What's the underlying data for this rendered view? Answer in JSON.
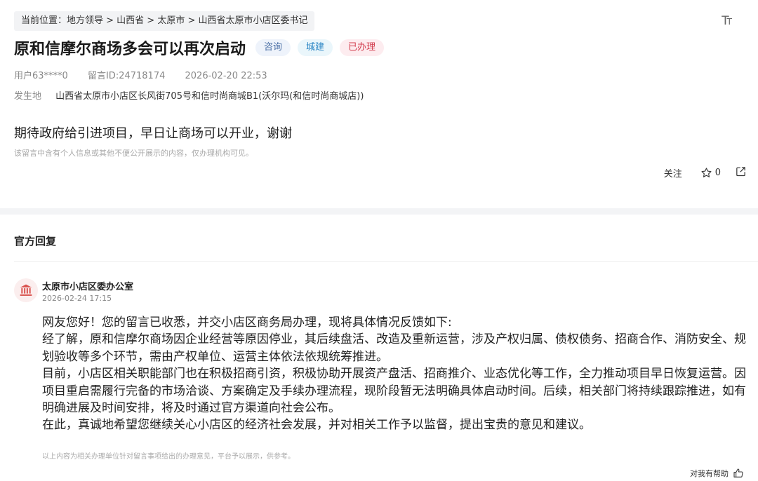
{
  "breadcrumb": "当前位置：地方领导 > 山西省 > 太原市 > 山西省太原市小店区委书记",
  "font_toggle": {
    "big": "T",
    "small": "T"
  },
  "title": "原和信摩尔商场多会可以再次启动",
  "tags": {
    "consult": "咨询",
    "city": "城建",
    "status": "已办理"
  },
  "meta": {
    "user": "用户63****0",
    "message_id": "留言ID:24718174",
    "datetime": "2026-02-20 22:53"
  },
  "location": {
    "label": "发生地",
    "value": "山西省太原市小店区长风街705号和信时尚商城B1(沃尔玛(和信时尚商城店))"
  },
  "content": "期待政府给引进项目，早日让商场可以开业，谢谢",
  "privacy_note": "该留言中含有个人信息或其他不便公开展示的内容，仅办理机构可见。",
  "actions": {
    "follow": "关注",
    "star_count": "0"
  },
  "official": {
    "section_title": "官方回复",
    "office": "太原市小店区委办公室",
    "time": "2026-02-24 17:15",
    "reply": [
      "网友您好！您的留言已收悉，并交小店区商务局办理，现将具体情况反馈如下:",
      "经了解，原和信摩尔商场因企业经营等原因停业，其后续盘活、改造及重新运营，涉及产权归属、债权债务、招商合作、消防安全、规划验收等多个环节，需由产权单位、运营主体依法依规统筹推进。",
      "目前，小店区相关职能部门也在积极招商引资，积极协助开展资产盘活、招商推介、业态优化等工作，全力推动项目早日恢复运营。因项目重启需履行完备的市场洽谈、方案确定及手续办理流程，现阶段暂无法明确具体启动时间。后续，相关部门将持续跟踪推进，如有明确进展及时间安排，将及时通过官方渠道向社会公布。",
      "在此，真诚地希望您继续关心小店区的经济社会发展，并对相关工作予以监督，提出宝贵的意见和建议。"
    ],
    "disclaimer": "以上内容为相关办理单位针对留言事项给出的办理意见，平台予以展示，供参考。",
    "helpful": "对我有帮助"
  },
  "colors": {
    "status_red": "#d23b4c",
    "city_blue": "#2b86c5",
    "consult_blue": "#4a6fa5",
    "avatar_icon": "#d9534f"
  }
}
